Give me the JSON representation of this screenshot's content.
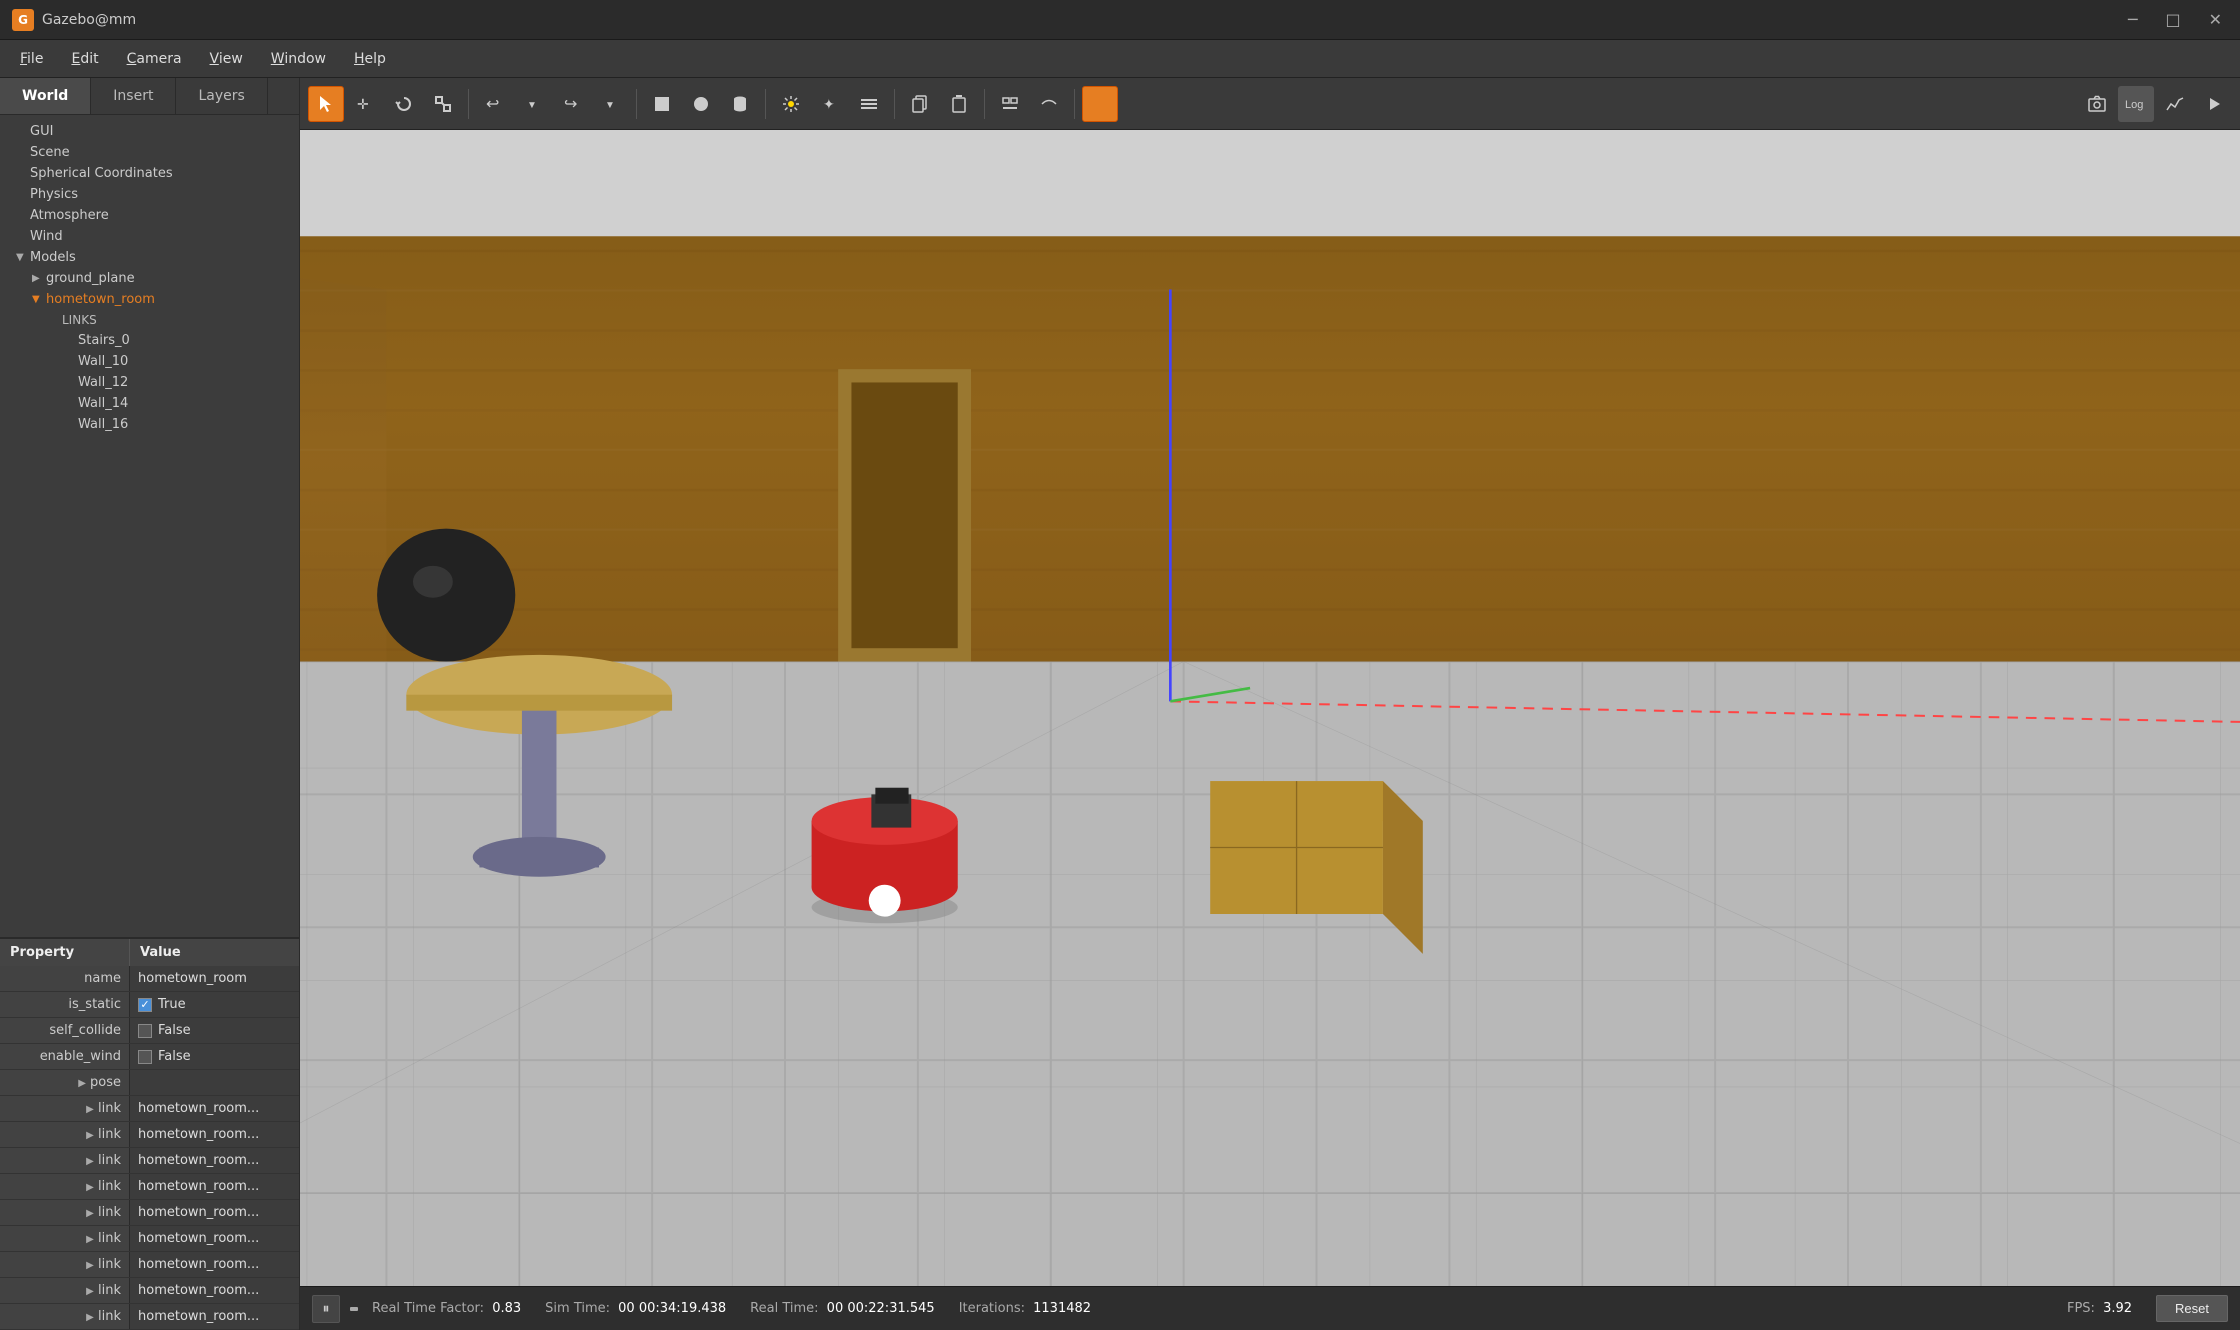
{
  "window": {
    "title": "Gazebo@mm",
    "icon": "G"
  },
  "titlebar": {
    "controls": [
      "─",
      "□",
      "✕"
    ]
  },
  "menubar": {
    "items": [
      {
        "label": "File",
        "key": "F"
      },
      {
        "label": "Edit",
        "key": "E"
      },
      {
        "label": "Camera",
        "key": "C"
      },
      {
        "label": "View",
        "key": "V"
      },
      {
        "label": "Window",
        "key": "W"
      },
      {
        "label": "Help",
        "key": "H"
      }
    ]
  },
  "tabs": [
    {
      "label": "World",
      "active": true
    },
    {
      "label": "Insert",
      "active": false
    },
    {
      "label": "Layers",
      "active": false
    }
  ],
  "world_tree": {
    "items": [
      {
        "label": "GUI",
        "indent": 1,
        "type": "leaf"
      },
      {
        "label": "Scene",
        "indent": 1,
        "type": "leaf"
      },
      {
        "label": "Spherical Coordinates",
        "indent": 1,
        "type": "leaf"
      },
      {
        "label": "Physics",
        "indent": 1,
        "type": "leaf"
      },
      {
        "label": "Atmosphere",
        "indent": 1,
        "type": "leaf"
      },
      {
        "label": "Wind",
        "indent": 1,
        "type": "leaf"
      },
      {
        "label": "Models",
        "indent": 1,
        "type": "parent",
        "expanded": true,
        "arrow": "▼"
      },
      {
        "label": "ground_plane",
        "indent": 2,
        "type": "parent",
        "expanded": false,
        "arrow": "▶"
      },
      {
        "label": "hometown_room",
        "indent": 2,
        "type": "parent",
        "expanded": true,
        "arrow": "▼",
        "highlighted": true
      },
      {
        "label": "LINKS",
        "indent": 3,
        "type": "header"
      },
      {
        "label": "Stairs_0",
        "indent": 4,
        "type": "leaf"
      },
      {
        "label": "Wall_10",
        "indent": 4,
        "type": "leaf"
      },
      {
        "label": "Wall_12",
        "indent": 4,
        "type": "leaf"
      },
      {
        "label": "Wall_14",
        "indent": 4,
        "type": "leaf"
      },
      {
        "label": "Wall_16",
        "indent": 4,
        "type": "leaf"
      }
    ]
  },
  "property_table": {
    "headers": [
      "Property",
      "Value"
    ],
    "rows": [
      {
        "type": "plain",
        "key": "name",
        "value": "hometown_room"
      },
      {
        "type": "checkbox",
        "key": "is_static",
        "value": "True",
        "checked": true
      },
      {
        "type": "checkbox",
        "key": "self_collide",
        "value": "False",
        "checked": false
      },
      {
        "type": "checkbox",
        "key": "enable_wind",
        "value": "False",
        "checked": false
      },
      {
        "type": "expand",
        "key": "pose",
        "value": ""
      },
      {
        "type": "link",
        "key": "link",
        "value": "hometown_room..."
      },
      {
        "type": "link",
        "key": "link",
        "value": "hometown_room..."
      },
      {
        "type": "link",
        "key": "link",
        "value": "hometown_room..."
      },
      {
        "type": "link",
        "key": "link",
        "value": "hometown_room..."
      },
      {
        "type": "link",
        "key": "link",
        "value": "hometown_room..."
      },
      {
        "type": "link",
        "key": "link",
        "value": "hometown_room..."
      },
      {
        "type": "link",
        "key": "link",
        "value": "hometown_room..."
      },
      {
        "type": "link",
        "key": "link",
        "value": "hometown_room..."
      },
      {
        "type": "link",
        "key": "link",
        "value": "hometown_room..."
      }
    ]
  },
  "toolbar": {
    "buttons": [
      {
        "icon": "↖",
        "label": "select",
        "active": true
      },
      {
        "icon": "✛",
        "label": "translate"
      },
      {
        "icon": "↻",
        "label": "rotate"
      },
      {
        "icon": "⤢",
        "label": "scale"
      },
      {
        "icon": "↩",
        "label": "undo"
      },
      {
        "icon": "⋯",
        "label": "undo-more"
      },
      {
        "icon": "↪",
        "label": "redo"
      },
      {
        "icon": "⋯",
        "label": "redo-more"
      },
      {
        "sep": true
      },
      {
        "icon": "⬛",
        "label": "box"
      },
      {
        "icon": "⬤",
        "label": "sphere"
      },
      {
        "icon": "⬡",
        "label": "cylinder"
      },
      {
        "sep": true
      },
      {
        "icon": "☀",
        "label": "point-light"
      },
      {
        "icon": "✦",
        "label": "spot-light"
      },
      {
        "icon": "≋",
        "label": "directional-light"
      },
      {
        "sep": true
      },
      {
        "icon": "⧉",
        "label": "copy"
      },
      {
        "icon": "⬚",
        "label": "paste"
      },
      {
        "sep": true
      },
      {
        "icon": "⊓",
        "label": "align-left"
      },
      {
        "icon": "⌒",
        "label": "align"
      },
      {
        "sep": true
      },
      {
        "icon": "🔶",
        "label": "orange-marker",
        "active": true
      },
      {
        "sep": true
      },
      {
        "icon": "📷",
        "label": "screenshot"
      },
      {
        "icon": "📊",
        "label": "log"
      },
      {
        "icon": "〜",
        "label": "plot"
      },
      {
        "icon": "🎬",
        "label": "record"
      }
    ]
  },
  "statusbar": {
    "play_icon": "⏸",
    "real_time_factor_label": "Real Time Factor:",
    "real_time_factor_value": "0.83",
    "sim_time_label": "Sim Time:",
    "sim_time_value": "00 00:34:19.438",
    "real_time_label": "Real Time:",
    "real_time_value": "00 00:22:31.545",
    "iterations_label": "Iterations:",
    "iterations_value": "1131482",
    "fps_label": "FPS:",
    "fps_value": "3.92",
    "reset_label": "Reset"
  },
  "colors": {
    "accent": "#e67e22",
    "wall_wood": "#8B6914",
    "floor_tile": "#b8b8b8",
    "selected_text": "#e67e22"
  }
}
